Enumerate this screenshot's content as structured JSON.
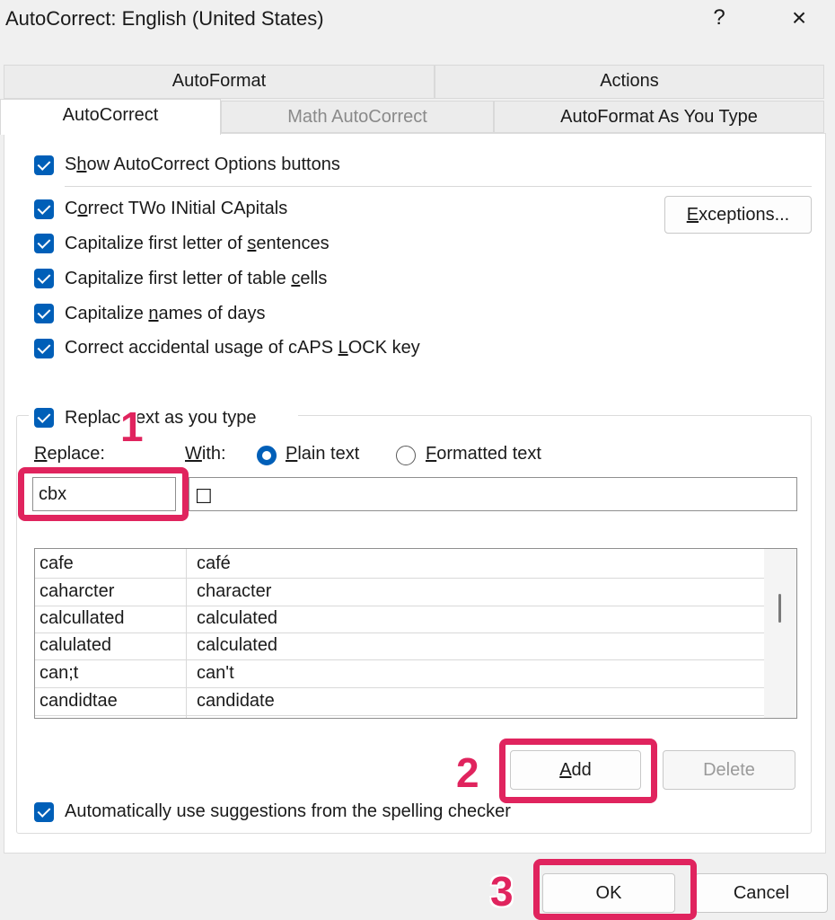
{
  "window": {
    "title": "AutoCorrect: English (United States)",
    "help_label": "?",
    "close_label": "×"
  },
  "tabs": {
    "row1": [
      {
        "label": "AutoFormat"
      },
      {
        "label": "Actions"
      }
    ],
    "row2": [
      {
        "label": "AutoCorrect",
        "active": true
      },
      {
        "label": "Math AutoCorrect",
        "disabled": true
      },
      {
        "label": "AutoFormat As You Type"
      }
    ]
  },
  "options": {
    "show_buttons": {
      "pre": "S",
      "u": "h",
      "post": "ow AutoCorrect Options buttons"
    },
    "two_initial": {
      "pre": "C",
      "u": "o",
      "post": "rrect TWo INitial CApitals"
    },
    "first_sentence": {
      "pre": "Capitalize first letter of ",
      "u": "s",
      "post": "entences"
    },
    "first_table": {
      "pre": "Capitalize first letter of table ",
      "u": "c",
      "post": "ells"
    },
    "names_days": {
      "pre": "Capitalize ",
      "u": "n",
      "post": "ames of days"
    },
    "caps_lock": {
      "pre": "Correct accidental usage of cAPS ",
      "u": "L",
      "post": "OCK key"
    },
    "replace_text": {
      "pre": "Replac",
      "u": "",
      "post": "ext as you type"
    },
    "spelling": {
      "pre": "Automatically use su",
      "u": "g",
      "post": "gestions from the spelling checker"
    }
  },
  "exceptions_button": {
    "u": "E",
    "post": "xceptions..."
  },
  "replace_label": {
    "u": "R",
    "post": "eplace:"
  },
  "with_label": {
    "u": "W",
    "post": "ith:"
  },
  "plain_text": {
    "u": "P",
    "post": "lain text"
  },
  "formatted_text": {
    "u": "F",
    "post": "ormatted text"
  },
  "replace_value": "cbx",
  "with_value": "☐",
  "entries": [
    {
      "replace": "cafe",
      "with": "café"
    },
    {
      "replace": "caharcter",
      "with": "character"
    },
    {
      "replace": "calcullated",
      "with": "calculated"
    },
    {
      "replace": "calulated",
      "with": "calculated"
    },
    {
      "replace": "can;t",
      "with": "can't"
    },
    {
      "replace": "candidtae",
      "with": "candidate"
    }
  ],
  "buttons": {
    "add": {
      "u": "A",
      "post": "dd"
    },
    "delete": "Delete",
    "ok": "OK",
    "cancel": "Cancel"
  },
  "annotations": [
    "1",
    "2",
    "3"
  ],
  "colors": {
    "accent": "#005fb8",
    "annotation": "#e0245e"
  }
}
